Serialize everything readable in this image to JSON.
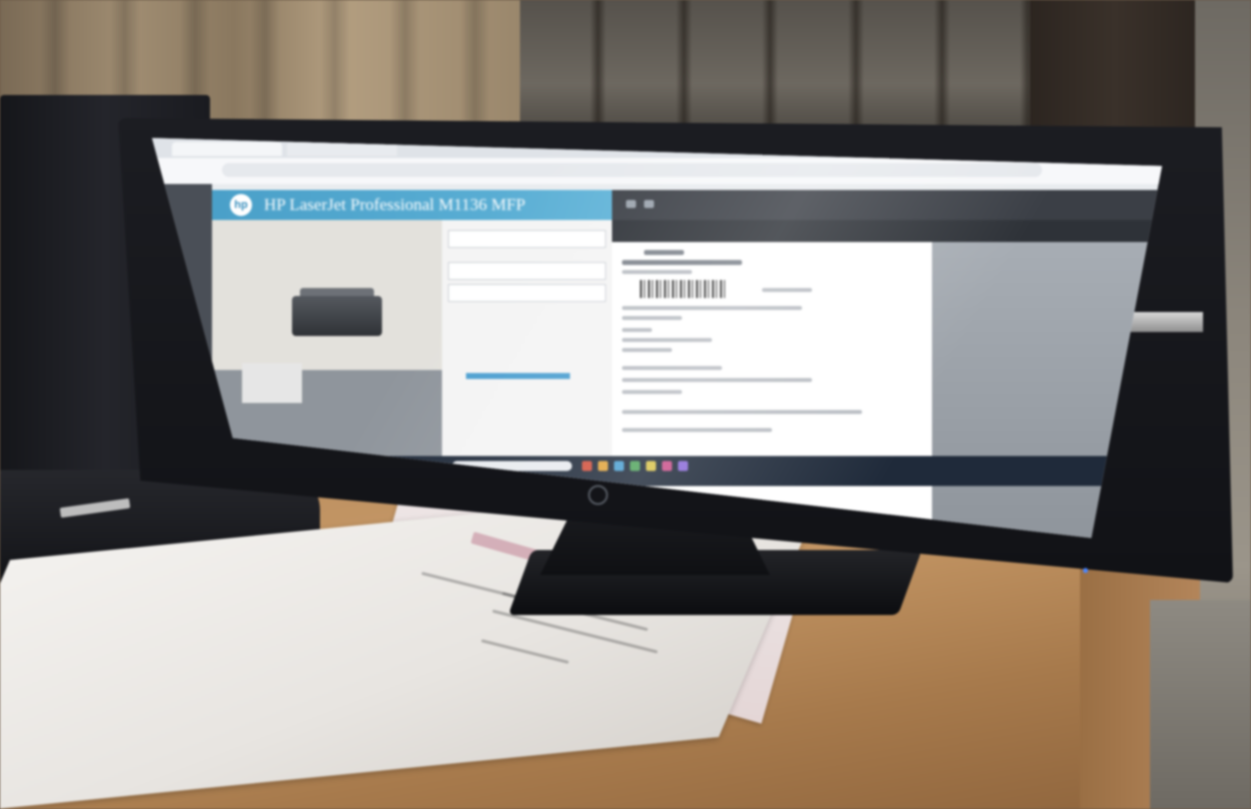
{
  "scene": {
    "description_kind": "photo of a desktop monitor",
    "screen": {
      "header_title": "HP LaserJet Professional M1136 MFP",
      "header_logo": "hp"
    },
    "colors": {
      "hp_header": "#4aa0c9",
      "dark_toolbar": "#3b3f46",
      "taskbar": "#1f2a3a",
      "desk": "#c89a68"
    },
    "icons": [
      "hp-logo-icon",
      "barcode",
      "printer-image",
      "power-indicator-icon"
    ]
  }
}
